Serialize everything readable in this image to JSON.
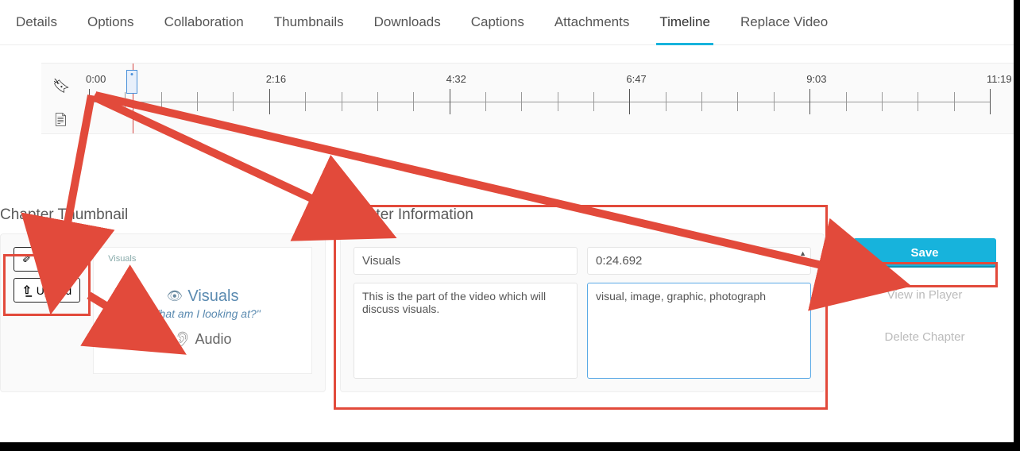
{
  "tabs": {
    "details": "Details",
    "options": "Options",
    "collaboration": "Collaboration",
    "thumbnails": "Thumbnails",
    "downloads": "Downloads",
    "captions": "Captions",
    "attachments": "Attachments",
    "timeline": "Timeline",
    "replace_video": "Replace Video"
  },
  "active_tab": "timeline",
  "timeline": {
    "labels": [
      "0:00",
      "2:16",
      "4:32",
      "6:47",
      "9:03",
      "11:19"
    ],
    "major_ticks": 6,
    "minor_per_major": 4,
    "playhead_time": "0:24.692"
  },
  "chapter_thumbnail": {
    "title": "Chapter Thumbnail",
    "auto_label": "Auto",
    "upload_label": "Upload",
    "preview": {
      "mini": "Visuals",
      "big": "Visuals",
      "sub": "\"What am I looking at?\"",
      "audio": "Audio"
    }
  },
  "chapter_info": {
    "title": "Chapter Information",
    "name": "Visuals",
    "time": "0:24.692",
    "description": "This is the part of the video which will discuss visuals.",
    "tags": "visual, image, graphic, photograph"
  },
  "actions": {
    "save": "Save",
    "view": "View in Player",
    "delete": "Delete Chapter"
  }
}
